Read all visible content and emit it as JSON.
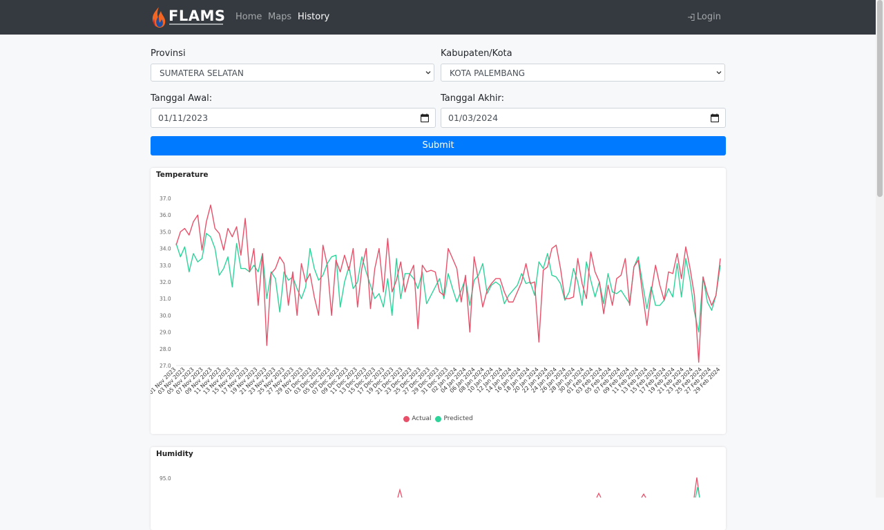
{
  "nav": {
    "brand": "FLAMS",
    "links": [
      "Home",
      "Maps",
      "History"
    ],
    "active": "History",
    "login": "Login"
  },
  "form": {
    "provinsi_label": "Provinsi",
    "provinsi_value": "SUMATERA SELATAN",
    "kabupaten_label": "Kabupaten/Kota",
    "kabupaten_value": "KOTA PALEMBANG",
    "start_label": "Tanggal Awal:",
    "start_value": "01/11/2023",
    "end_label": "Tanggal Akhir:",
    "end_value": "01/03/2024",
    "submit": "Submit"
  },
  "colors": {
    "actual": "#e8506a",
    "predicted": "#2ed39a",
    "accent": "#007bff",
    "navbar": "#343a40"
  },
  "chart_data": [
    {
      "type": "line",
      "title": "Temperature",
      "ylim": [
        27.0,
        37.0
      ],
      "yticks": [
        "27.0",
        "28.0",
        "29.0",
        "30.0",
        "31.0",
        "32.0",
        "33.0",
        "34.0",
        "35.0",
        "36.0",
        "37.0"
      ],
      "xticks": [
        "01 Nov 2023",
        "03 Nov 2023",
        "05 Nov 2023",
        "07 Nov 2023",
        "09 Nov 2023",
        "11 Nov 2023",
        "13 Nov 2023",
        "15 Nov 2023",
        "17 Nov 2023",
        "19 Nov 2023",
        "21 Nov 2023",
        "23 Nov 2023",
        "25 Nov 2023",
        "27 Nov 2023",
        "29 Nov 2023",
        "01 Dec 2023",
        "03 Dec 2023",
        "05 Dec 2023",
        "07 Dec 2023",
        "09 Dec 2023",
        "11 Dec 2023",
        "13 Dec 2023",
        "15 Dec 2023",
        "17 Dec 2023",
        "19 Dec 2023",
        "21 Dec 2023",
        "23 Dec 2023",
        "25 Dec 2023",
        "27 Dec 2023",
        "29 Dec 2023",
        "31 Dec 2023",
        "02 Jan 2024",
        "04 Jan 2024",
        "06 Jan 2024",
        "08 Jan 2024",
        "10 Jan 2024",
        "12 Jan 2024",
        "14 Jan 2024",
        "16 Jan 2024",
        "18 Jan 2024",
        "20 Jan 2024",
        "22 Jan 2024",
        "24 Jan 2024",
        "26 Jan 2024",
        "28 Jan 2024",
        "30 Jan 2024",
        "01 Feb 2024",
        "03 Feb 2024",
        "05 Feb 2024",
        "07 Feb 2024",
        "09 Feb 2024",
        "11 Feb 2024",
        "13 Feb 2024",
        "15 Feb 2024",
        "17 Feb 2024",
        "19 Feb 2024",
        "21 Feb 2024",
        "23 Feb 2024",
        "25 Feb 2024",
        "27 Feb 2024",
        "29 Feb 2024"
      ],
      "series": [
        {
          "name": "Actual",
          "values": [
            34.2,
            35.0,
            35.2,
            34.8,
            35.6,
            36.0,
            33.9,
            35.6,
            36.6,
            35.2,
            34.9,
            33.9,
            35.2,
            34.7,
            35.3,
            33.6,
            35.8,
            32.6,
            34.0,
            30.6,
            33.7,
            28.2,
            32.5,
            32.8,
            33.5,
            33.1,
            30.6,
            32.6,
            30.0,
            33.1,
            32.0,
            32.5,
            31.1,
            30.0,
            34.2,
            33.0,
            30.0,
            33.3,
            32.6,
            33.6,
            32.7,
            34.0,
            30.5,
            32.8,
            34.0,
            30.4,
            32.8,
            34.0,
            31.4,
            34.6,
            31.4,
            32.1,
            33.2,
            31.4,
            32.4,
            33.0,
            29.2,
            33.0,
            32.6,
            32.7,
            32.6,
            31.4,
            31.2,
            34.0,
            33.4,
            32.8,
            30.8,
            32.4,
            29.0,
            33.5,
            32.1,
            30.5,
            31.5,
            31.9,
            32.2,
            32.2,
            31.4,
            30.8,
            30.8,
            31.4,
            32.0,
            33.1,
            31.9,
            32.0,
            28.4,
            32.7,
            32.9,
            34.0,
            34.2,
            32.8,
            31.0,
            31.0,
            31.1,
            33.4,
            31.9,
            31.0,
            33.8,
            32.6,
            32.0,
            30.1,
            31.8,
            30.6,
            32.2,
            32.4,
            33.4,
            30.6,
            32.9,
            33.3,
            31.3,
            29.4,
            31.4,
            33.0,
            31.8,
            30.9,
            32.6,
            32.5,
            33.7,
            32.2,
            34.1,
            32.8,
            31.2,
            27.2,
            32.3,
            31.3,
            30.6,
            31.2,
            33.4
          ],
          "color": "#e8506a"
        },
        {
          "name": "Predicted",
          "values": [
            34.3,
            33.5,
            34.1,
            32.6,
            33.7,
            33.2,
            33.4,
            34.9,
            34.7,
            34.0,
            32.4,
            32.8,
            33.5,
            31.7,
            34.3,
            32.8,
            32.8,
            32.6,
            33.0,
            32.6,
            33.7,
            31.0,
            32.6,
            32.2,
            30.2,
            32.6,
            32.1,
            32.3,
            31.6,
            31.0,
            31.7,
            34.0,
            32.8,
            32.1,
            32.4,
            33.1,
            33.5,
            33.6,
            30.5,
            32.0,
            32.9,
            31.6,
            32.0,
            33.5,
            32.6,
            31.8,
            31.0,
            31.3,
            30.5,
            32.2,
            30.0,
            33.4,
            31.0,
            32.5,
            32.5,
            32.2,
            31.6,
            32.6,
            30.7,
            31.2,
            31.7,
            32.2,
            31.0,
            32.5,
            31.6,
            30.8,
            31.5,
            32.2,
            30.6,
            32.1,
            32.4,
            33.1,
            31.3,
            31.8,
            32.0,
            31.8,
            30.7,
            31.2,
            31.5,
            31.8,
            32.5,
            31.9,
            32.0,
            31.2,
            33.2,
            32.8,
            33.7,
            32.4,
            32.3,
            31.9,
            30.9,
            31.4,
            32.8,
            32.0,
            30.6,
            33.2,
            32.1,
            31.1,
            32.0,
            30.7,
            32.5,
            31.4,
            31.3,
            31.5,
            31.1,
            30.7,
            32.9,
            33.5,
            31.9,
            30.4,
            31.7,
            30.6,
            30.6,
            30.9,
            31.6,
            31.1,
            33.1,
            31.1,
            33.4,
            32.1,
            30.2,
            29.0,
            32.3,
            30.8,
            30.3,
            31.2,
            33.0
          ],
          "color": "#2ed39a"
        }
      ]
    },
    {
      "type": "line",
      "title": "Humidity",
      "yticks": [
        "95.0"
      ],
      "note": "partially visible"
    }
  ]
}
